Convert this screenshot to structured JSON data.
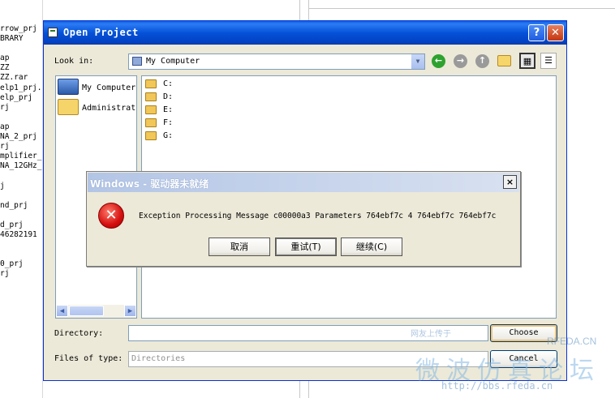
{
  "background_list": [
    "rrow_prj",
    "BRARY",
    "",
    "ap",
    "ZZ",
    "ZZ.rar",
    "elp1_prj.",
    "elp_prj",
    "rj",
    "",
    "ap",
    "NA_2_prj",
    "rj",
    "mplifier_",
    "NA_12GHz_",
    "",
    "j",
    "",
    "nd_prj",
    "",
    "d_prj",
    "46282191",
    "",
    "",
    "0_prj",
    "rj"
  ],
  "dialog": {
    "title": "Open Project",
    "help_label": "?",
    "close_label": "✕",
    "look_in_label": "Look in:",
    "look_in_value": "My Computer",
    "places": [
      "My Computer",
      "Administrat"
    ],
    "drives": [
      "C:",
      "D:",
      "E:",
      "F:",
      "G:"
    ],
    "directory_label": "Directory:",
    "directory_value": "",
    "files_of_type_label": "Files of type:",
    "files_of_type_value": "Directories",
    "choose_label": "Choose",
    "cancel_label": "Cancel",
    "icons": [
      "back-icon",
      "forward-icon",
      "up-folder-icon",
      "new-folder-icon",
      "list-view-icon",
      "details-view-icon"
    ]
  },
  "error_dialog": {
    "title": "Windows - 驱动器未就绪",
    "message": "Exception Processing Message c00000a3 Parameters 764ebf7c 4 764ebf7c 764ebf7c",
    "buttons": [
      "取消",
      "重试(T)",
      "继续(C)"
    ],
    "close_label": "×"
  },
  "watermark": {
    "top_text": "网友上传于",
    "brand": "RFEDA.CN",
    "title": "微波仿真论坛",
    "url": "http://bbs.rfeda.cn"
  },
  "colors": {
    "titlebar": "#0452d8",
    "dialog_bg": "#ece9d8",
    "error_title": "#b3c5e6"
  }
}
